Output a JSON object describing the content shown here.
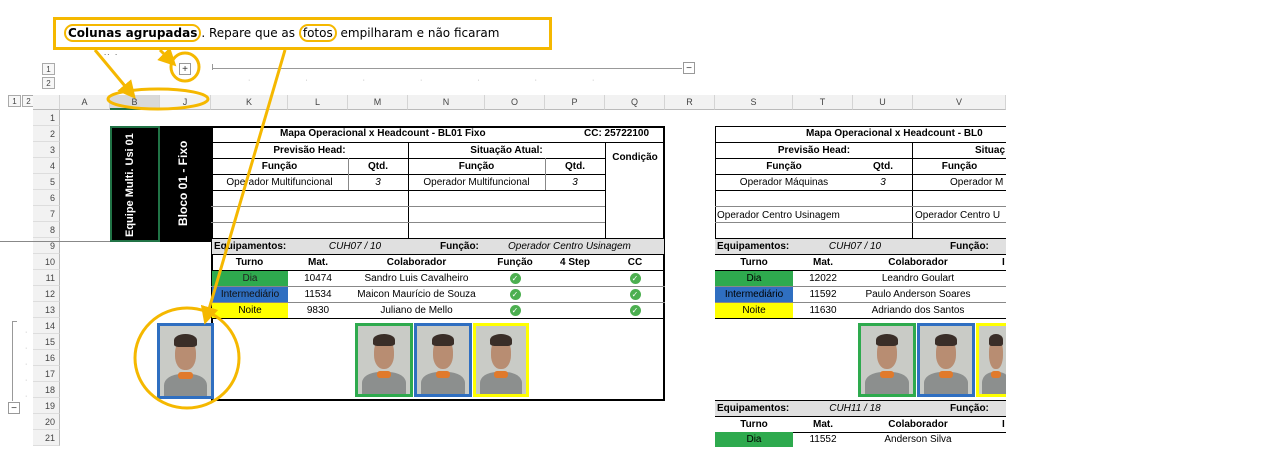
{
  "callout": {
    "highlight1": "Colunas agrupadas",
    "text1": ". Repare que as ",
    "highlight2": "fotos",
    "text2": " empilharam e não ficaram escondidas."
  },
  "outline": {
    "top_levels": [
      "1",
      "2"
    ],
    "left_levels": [
      "1",
      "2"
    ],
    "expand_button": "+",
    "collapse_button": "−",
    "row_collapse_button": "−"
  },
  "columns": [
    "A",
    "B",
    "J",
    "K",
    "L",
    "M",
    "N",
    "O",
    "P",
    "Q",
    "R",
    "S",
    "T",
    "U",
    "V"
  ],
  "rows": [
    "1",
    "2",
    "3",
    "4",
    "5",
    "6",
    "7",
    "8",
    "9",
    "10",
    "11",
    "12",
    "13",
    "14",
    "15",
    "16",
    "17",
    "18",
    "19",
    "20",
    "21"
  ],
  "vertical_labels": {
    "equipe": "Equipe Multi. Usi 01",
    "bloco": "Bloco 01 - Fixo"
  },
  "block1": {
    "title": "Mapa Operacional x Headcount - BL01 Fixo",
    "cc": "CC: 25722100",
    "previsao": "Previsão Head:",
    "situacao": "Situação Atual:",
    "condicao": "Condição",
    "funcao": "Função",
    "qtd": "Qtd.",
    "funcao2": "Função",
    "qtd2": "Qtd.",
    "prev_role": "Operador Multifuncional",
    "prev_qtd": "3",
    "sit_role": "Operador Multifuncional",
    "sit_qtd": "3",
    "equip_label": "Equipamentos:",
    "equip_value": "CUH07 / 10",
    "func_label": "Função:",
    "func_value": "Operador Centro Usinagem",
    "headers": [
      "Turno",
      "Mat.",
      "Colaborador",
      "Função",
      "4 Step",
      "CC"
    ],
    "rows": [
      {
        "turno": "Dia",
        "mat": "10474",
        "nome": "Sandro Luis Cavalheiro"
      },
      {
        "turno": "Intermediário",
        "mat": "11534",
        "nome": "Maicon Maurício de Souza"
      },
      {
        "turno": "Noite",
        "mat": "9830",
        "nome": "Juliano de Mello"
      }
    ]
  },
  "block2": {
    "title": "Mapa Operacional x Headcount - BL0",
    "previsao": "Previsão Head:",
    "situacao": "Situaç",
    "funcao": "Função",
    "qtd": "Qtd.",
    "funcao2": "Função",
    "prev_role": "Operador Máquinas",
    "prev_qtd": "3",
    "sit_role": "Operador M",
    "row7_left": "Operador Centro Usinagem",
    "row7_right": "Operador Centro U",
    "equip_label": "Equipamentos:",
    "equip_value": "CUH07 / 10",
    "func_label": "Função:",
    "headers": [
      "Turno",
      "Mat.",
      "Colaborador",
      "I"
    ],
    "rows": [
      {
        "turno": "Dia",
        "mat": "12022",
        "nome": "Leandro Goulart"
      },
      {
        "turno": "Intermediário",
        "mat": "11592",
        "nome": "Paulo Anderson Soares"
      },
      {
        "turno": "Noite",
        "mat": "11630",
        "nome": "Adriando dos Santos"
      }
    ],
    "equip2_label": "Equipamentos:",
    "equip2_value": "CUH11 / 18",
    "func2_label": "Função:",
    "headers2": [
      "Turno",
      "Mat.",
      "Colaborador",
      "I"
    ],
    "row20": {
      "turno": "Dia",
      "mat": "11552",
      "nome": "Anderson Silva"
    }
  },
  "colors": {
    "callout": "#f5b800",
    "dia": "#2eaa4e",
    "intermediario": "#2f6fc1",
    "noite": "#ffff00",
    "check": "#4caf50"
  }
}
